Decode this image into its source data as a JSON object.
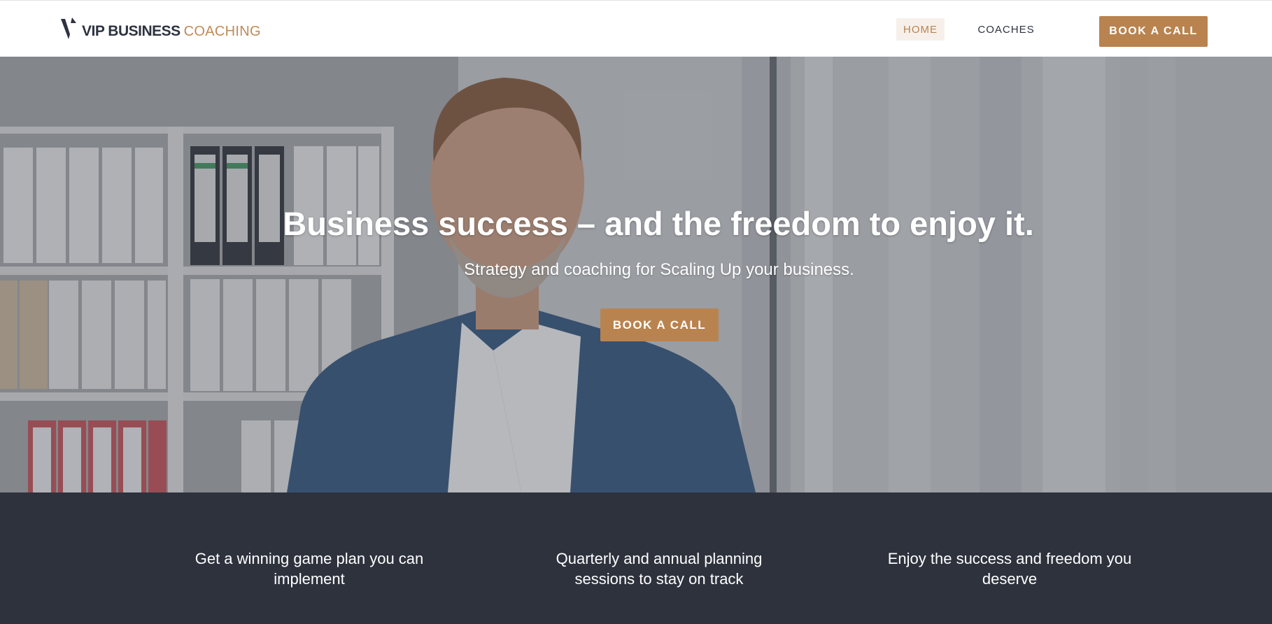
{
  "header": {
    "logo_primary": "VIP BUSINESS",
    "logo_secondary": "COACHING",
    "nav": [
      {
        "label": "HOME",
        "active": true
      },
      {
        "label": "COACHES",
        "active": false
      }
    ],
    "cta_label": "BOOK A CALL"
  },
  "hero": {
    "title": "Business success – and the freedom to enjoy it.",
    "subtitle": "Strategy and coaching for Scaling Up your business.",
    "cta_label": "BOOK A CALL"
  },
  "features": [
    {
      "text": "Get a winning game plan you can implement"
    },
    {
      "text": "Quarterly and annual planning sessions to stay on track"
    },
    {
      "text": "Enjoy the success and freedom you deserve"
    }
  ],
  "colors": {
    "accent": "#b9834f",
    "dark": "#2d323d",
    "nav_active_bg": "#f7f0ea"
  }
}
